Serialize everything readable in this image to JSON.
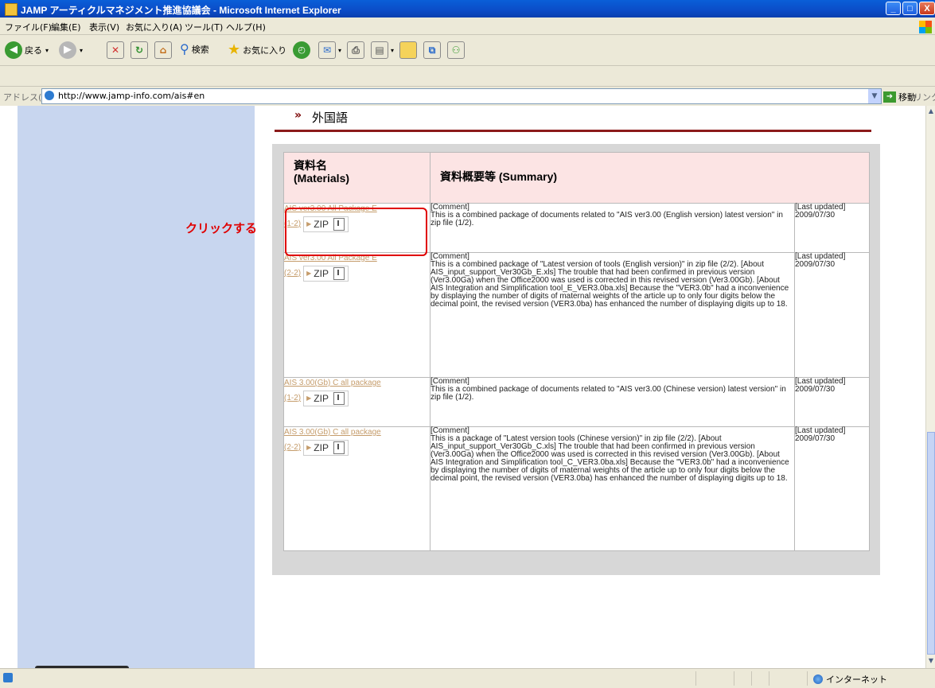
{
  "window": {
    "title": "JAMP アーティクルマネジメント推進協議会 - Microsoft Internet Explorer",
    "controls": {
      "minimize": "_",
      "maximize": "□",
      "close": "X"
    }
  },
  "menu": [
    "ファイル(F)",
    "編集(E)",
    "表示(V)",
    "お気に入り(A)",
    "ツール(T)",
    "ヘルプ(H)"
  ],
  "toolbar": {
    "back": "戻る",
    "search": "検索",
    "favorites": "お気に入り",
    "icons": [
      "back-icon",
      "forward-icon",
      "stop-icon",
      "refresh-icon",
      "home-icon",
      "search-icon",
      "favorites-star-icon",
      "history-icon",
      "mail-icon",
      "print-icon",
      "edit-icon",
      "discuss-icon",
      "research-icon",
      "messenger-icon"
    ]
  },
  "address": {
    "label": "アドレス(D)",
    "url": "http://www.jamp-info.com/ais#en",
    "go": "移動",
    "links": "リンク"
  },
  "section": {
    "chevron": "»",
    "title": "外国語"
  },
  "table": {
    "headers": {
      "materials_ja": "資料名",
      "materials_en": "(Materials)",
      "summary": "資料概要等 (Summary)"
    },
    "zip_label": "ZIP",
    "rows": [
      {
        "link": "AIS ver3.00 All Package E",
        "part": "(1-2)",
        "comment_label": "[Comment]",
        "summary": "This is a combined package of documents related to \"AIS ver3.00 (English version) latest version\" in zip file (1/2).",
        "updated_label": "[Last updated]",
        "date": "2009/07/30"
      },
      {
        "link": "AIS ver3.00 All Package E",
        "part": "(2-2)",
        "comment_label": "[Comment]",
        "summary": "This is a combined package of \"Latest version of tools (English version)\" in zip file (2/2). [About AIS_input_support_Ver30Gb_E.xls] The trouble that had been confirmed in previous version (Ver3.00Ga) when the Office2000 was used is corrected in this revised version (Ver3.00Gb). [About AIS Integration and Simplification tool_E_VER3.0ba.xls] Because the \"VER3.0b\" had a inconvenience by displaying the number of digits of maternal weights of the article up to only four digits below the decimal point, the revised version (VER3.0ba) has enhanced the number of displaying digits up to 18.",
        "updated_label": "[Last updated]",
        "date": "2009/07/30"
      },
      {
        "link": "AIS 3.00(Gb) C all package",
        "part": "(1-2)",
        "comment_label": "[Comment]",
        "summary": "This is a combined package of documents related to \"AIS ver3.00 (Chinese version) latest version\" in zip file (1/2).",
        "updated_label": "[Last updated]",
        "date": "2009/07/30"
      },
      {
        "link": "AIS 3.00(Gb) C all package",
        "part": "(2-2)",
        "comment_label": "[Comment]",
        "summary": "This is a package of \"Latest version tools (Chinese version)\" in zip file (2/2). [About AIS_input_support_Ver30Gb_C.xls] The trouble that had been confirmed in previous version (Ver3.00Ga) when the Office2000 was used is corrected in this revised version (Ver3.00Gb). [About AIS Integration and Simplification tool_C_VER3.0ba.xls] Because the \"VER3.0b\" had a inconvenience by displaying the number of digits of maternal weights of the article up to only four digits below the decimal point, the revised version (VER3.0ba) has enhanced the number of displaying digits up to 18.",
        "updated_label": "[Last updated]",
        "date": "2009/07/30"
      }
    ]
  },
  "annotation": {
    "label": "クリックする",
    "color": "#e00000"
  },
  "status": {
    "zone": "インターネット"
  },
  "colors": {
    "title_bar": "#0b4cc7",
    "left_column": "#c8d6ef",
    "table_header": "#fce4e4",
    "section_rule": "#8b1a1a",
    "link": "#c59c6b"
  }
}
